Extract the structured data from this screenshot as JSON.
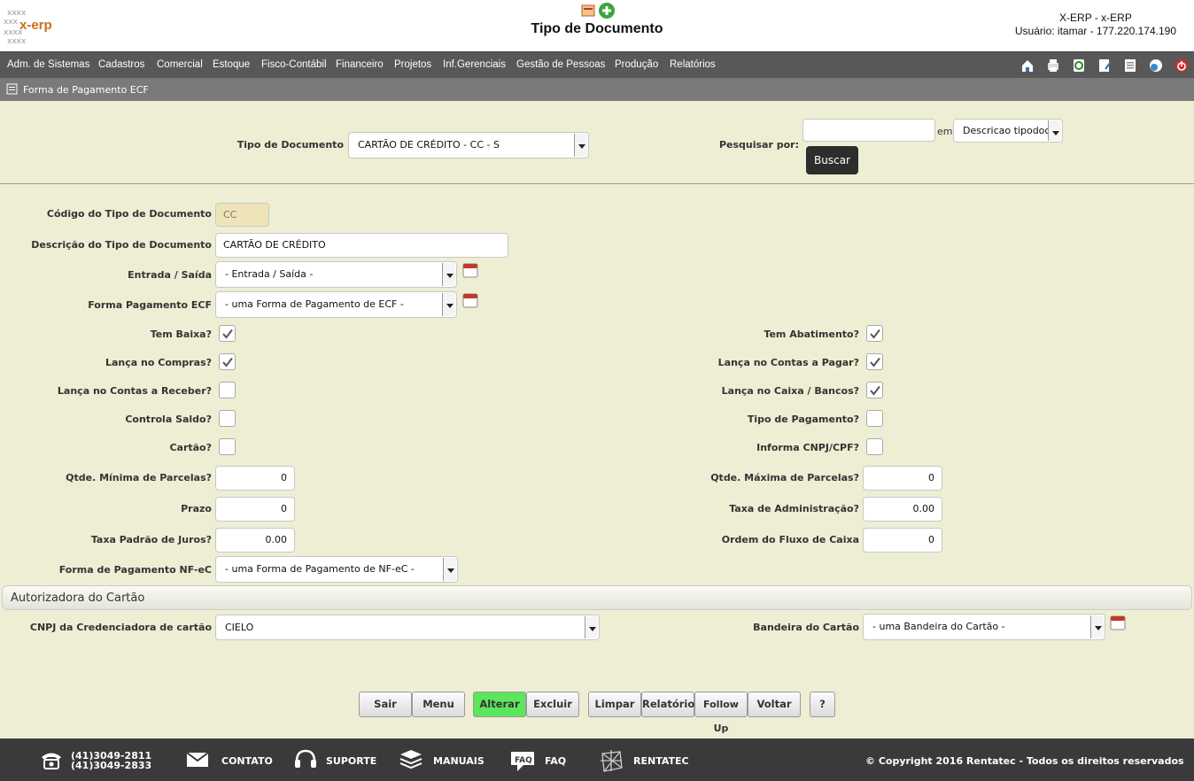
{
  "header": {
    "logo_text": "x-erp",
    "title": "Tipo de Documento",
    "system": "X-ERP - x-ERP",
    "user": "Usuário: itamar - 177.220.174.190"
  },
  "menu": [
    "Adm. de Sistemas",
    "Cadastros",
    "Comercial",
    "Estoque",
    "Fisco-Contábil",
    "Financeiro",
    "Projetos",
    "Inf.Gerenciais",
    "Gestão de Pessoas",
    "Produção",
    "Relatórios"
  ],
  "breadcrumb": "Forma de Pagamento ECF",
  "search": {
    "tipo_label": "Tipo de Documento",
    "tipo_value": "CARTÃO DE CRÉDITO - CC - S",
    "pesquisar_label": "Pesquisar por:",
    "pesquisar_value": "",
    "em_label": "em",
    "campo_value": "Descricao tipodoc",
    "buscar_label": "Buscar"
  },
  "form": {
    "codigo_label": "Código do Tipo de Documento",
    "codigo_value": "CC",
    "descricao_label": "Descrição do Tipo de Documento",
    "descricao_value": "CARTÃO DE CRÉDITO",
    "entrada_label": "Entrada / Saída",
    "entrada_value": "- Entrada / Saída -",
    "forma_ecf_label": "Forma Pagamento ECF",
    "forma_ecf_value": "- uma Forma de Pagamento de ECF -",
    "tem_baixa_label": "Tem Baixa?",
    "tem_baixa": true,
    "lanca_compras_label": "Lança no Compras?",
    "lanca_compras": true,
    "lanca_receber_label": "Lança no Contas a Receber?",
    "lanca_receber": false,
    "controla_saldo_label": "Controla Saldo?",
    "controla_saldo": false,
    "cartao_label": "Cartão?",
    "cartao": false,
    "tem_abatimento_label": "Tem Abatimento?",
    "tem_abatimento": true,
    "lanca_pagar_label": "Lança no Contas a Pagar?",
    "lanca_pagar": true,
    "lanca_caixa_label": "Lança no Caixa / Bancos?",
    "lanca_caixa": true,
    "tipo_pagamento_label": "Tipo de Pagamento?",
    "tipo_pagamento": false,
    "informa_cnpj_label": "Informa CNPJ/CPF?",
    "informa_cnpj": false,
    "qtde_min_label": "Qtde. Mínima de Parcelas?",
    "qtde_min_value": "0",
    "prazo_label": "Prazo",
    "prazo_value": "0",
    "taxa_juros_label": "Taxa Padrão de Juros?",
    "taxa_juros_value": "0.00",
    "forma_nfe_label": "Forma de Pagamento NF-eC",
    "forma_nfe_value": "- uma Forma de Pagamento de NF-eC -",
    "qtde_max_label": "Qtde. Máxima de Parcelas?",
    "qtde_max_value": "0",
    "taxa_adm_label": "Taxa de Administração?",
    "taxa_adm_value": "0.00",
    "ordem_fluxo_label": "Ordem do Fluxo de Caixa",
    "ordem_fluxo_value": "0"
  },
  "autorizadora": {
    "section_title": "Autorizadora do Cartão",
    "cnpj_label": "CNPJ da Credenciadora de cartão",
    "cnpj_value": "CIELO",
    "bandeira_label": "Bandeira do Cartão",
    "bandeira_value": "- uma Bandeira do Cartão -"
  },
  "actions": {
    "sair": "Sair",
    "menu": "Menu",
    "alterar": "Alterar",
    "excluir": "Excluir",
    "limpar": "Limpar",
    "relatorio": "Relatório",
    "follow_up": "Follow Up",
    "voltar": "Voltar",
    "help": "?"
  },
  "footer": {
    "phone1": "(41)3049-2811",
    "phone2": "(41)3049-2833",
    "contato": "CONTATO",
    "suporte": "SUPORTE",
    "manuais": "MANUAIS",
    "faq": "FAQ",
    "rentatec": "RENTATEC",
    "copyright": "© Copyright 2016 Rentatec - Todos os direitos reservados"
  },
  "colors": {
    "accent_active": "#5ce65c",
    "background": "#eeeed4",
    "menubar": "#585858"
  }
}
